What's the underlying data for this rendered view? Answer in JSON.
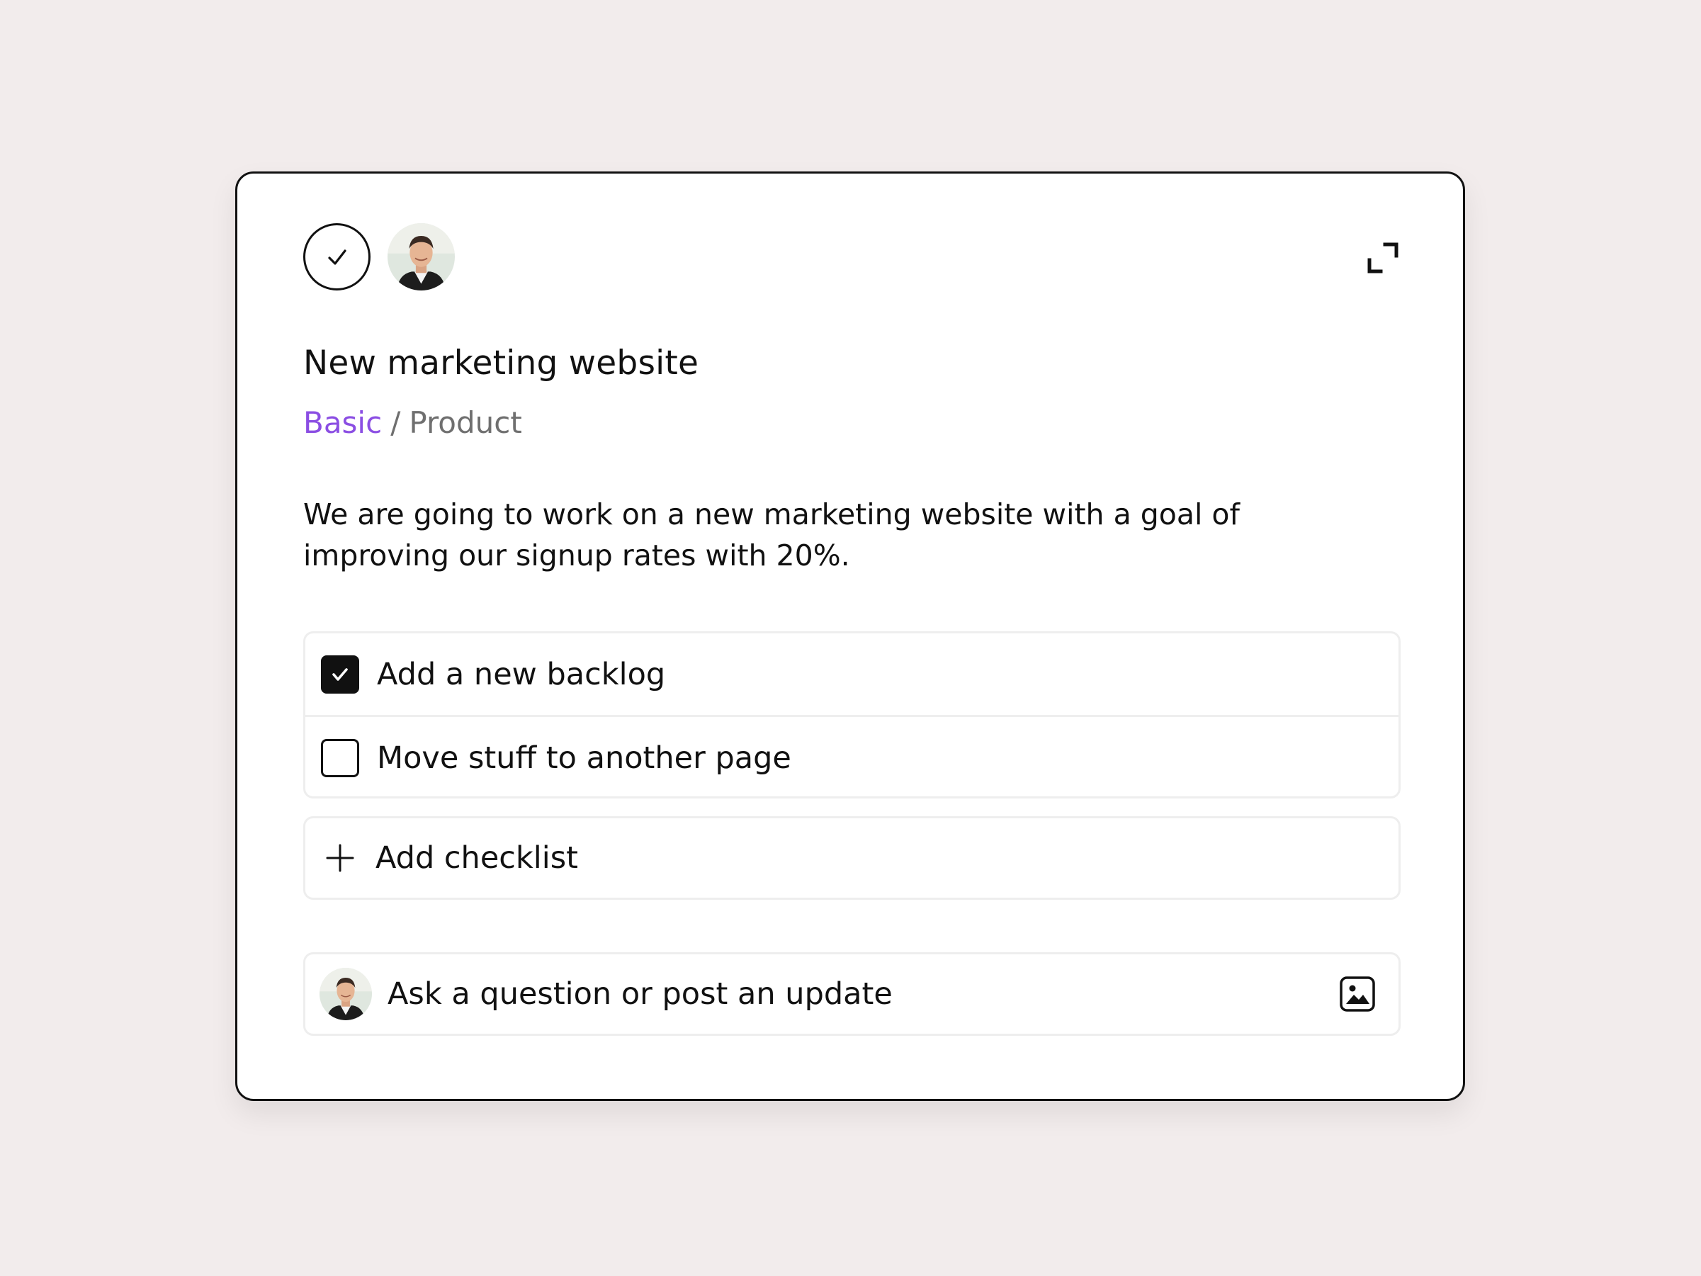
{
  "task": {
    "title": "New marketing website",
    "breadcrumb": {
      "project": "Basic",
      "separator": "/",
      "section": "Product"
    },
    "description": "We are going to work on a new marketing website with a goal of improving our signup rates with 20%."
  },
  "checklist": {
    "items": [
      {
        "label": "Add a new backlog",
        "checked": true
      },
      {
        "label": "Move stuff to another page",
        "checked": false
      }
    ],
    "add_label": "Add checklist"
  },
  "comment": {
    "placeholder": "Ask a question or post an update"
  },
  "icons": {
    "complete": "checkmark-icon",
    "expand": "expand-icon",
    "add": "plus-icon",
    "attach_image": "image-icon"
  },
  "colors": {
    "background": "#f2ecec",
    "accent": "#8b4ee3",
    "text": "#111111",
    "muted_text": "#6f6f6f",
    "border": "#eeeeee"
  }
}
